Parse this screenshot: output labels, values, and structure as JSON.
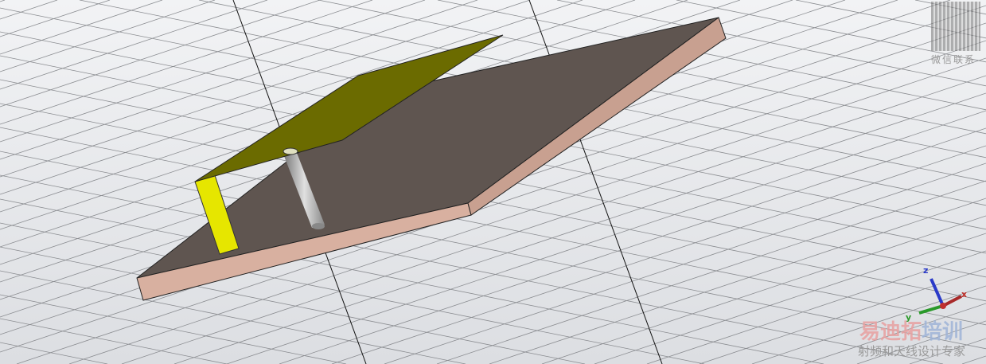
{
  "viewport": {
    "type": "3d-model-view"
  },
  "axes": {
    "x_label": "x",
    "y_label": "y",
    "z_label": "z",
    "x_color": "#c0302a",
    "y_color": "#2a9a2a",
    "z_color": "#2a3ac8"
  },
  "watermark": {
    "qr_caption": "微信联系",
    "brand_part1": "易迪拓",
    "brand_part2": "培训",
    "slogan": "射频和天线设计专家"
  },
  "colors": {
    "substrate_top": "#5f5550",
    "substrate_side": "#d8b0a0",
    "patch": "#6b6b00",
    "short_strip": "#e6e600",
    "feed_pin": "#a0a0a0"
  }
}
